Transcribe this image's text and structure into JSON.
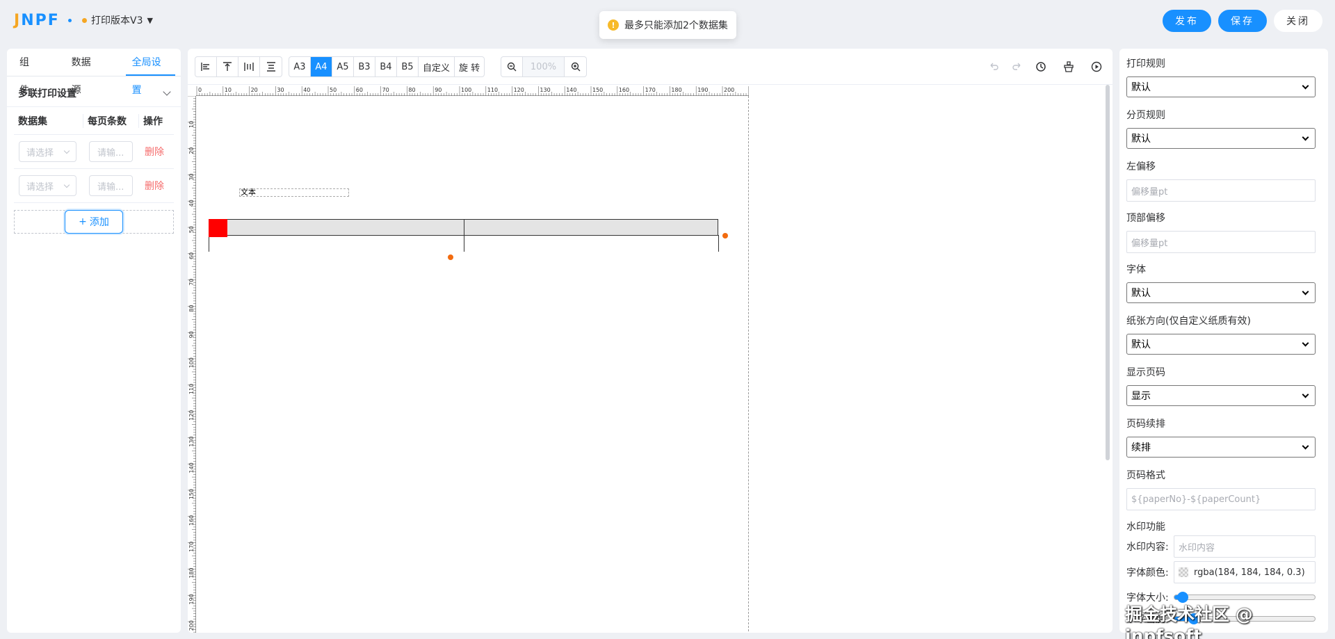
{
  "header": {
    "logo_j": "J",
    "logo_rest": "NPF",
    "version_label": "打印版本V3",
    "toast_text": "最多只能添加2个数据集",
    "buttons": {
      "publish": "发布",
      "save": "保存",
      "close": "关闭"
    },
    "accent_color": "#1890ff"
  },
  "left": {
    "tabs": [
      "组件",
      "数据源",
      "全局设置"
    ],
    "active_tab": "全局设置",
    "section_title": "多联打印设置",
    "table_headers": [
      "数据集",
      "每页条数",
      "操作"
    ],
    "rows": [
      {
        "dataset_placeholder": "请选择",
        "count_placeholder": "请输...",
        "action": "删除"
      },
      {
        "dataset_placeholder": "请选择",
        "count_placeholder": "请输...",
        "action": "删除"
      }
    ],
    "add_label": "添加"
  },
  "toolbar": {
    "paper_sizes": [
      "A3",
      "A4",
      "A5",
      "B3",
      "B4",
      "B5",
      "自定义",
      "旋 转"
    ],
    "active_paper": "A4",
    "zoom": "100%"
  },
  "ruler": {
    "top_marks": [
      "0",
      "10",
      "20",
      "30",
      "40",
      "50",
      "60",
      "70",
      "80",
      "90",
      "100",
      "110",
      "120",
      "130",
      "140",
      "150",
      "160",
      "170",
      "180",
      "190",
      "200"
    ],
    "left_marks": [
      "10",
      "20",
      "30",
      "40",
      "50",
      "60",
      "70",
      "80",
      "90",
      "100",
      "110",
      "120",
      "130",
      "140",
      "150",
      "160",
      "170",
      "180",
      "190",
      "200"
    ]
  },
  "canvas": {
    "text_element": "文本"
  },
  "right": {
    "print_rule": {
      "label": "打印规则",
      "value": "默认"
    },
    "page_rule": {
      "label": "分页规则",
      "value": "默认"
    },
    "left_offset": {
      "label": "左偏移",
      "placeholder": "偏移量pt"
    },
    "top_offset": {
      "label": "顶部偏移",
      "placeholder": "偏移量pt"
    },
    "font": {
      "label": "字体",
      "value": "默认"
    },
    "orientation": {
      "label": "纸张方向(仅自定义纸质有效)",
      "value": "默认"
    },
    "show_page": {
      "label": "显示页码",
      "value": "显示"
    },
    "page_continue": {
      "label": "页码续排",
      "value": "续排"
    },
    "page_format": {
      "label": "页码格式",
      "placeholder": "${paperNo}-${paperCount}"
    },
    "watermark": {
      "title": "水印功能",
      "content_label": "水印内容:",
      "content_placeholder": "水印内容",
      "color_label": "字体颜色:",
      "color_value": "rgba(184, 184, 184, 0.3)",
      "size_label": "字体大小:",
      "density_label": "水平密度:",
      "size_level": 0.06,
      "density_level": 0.14
    }
  },
  "overlay_watermark": "掘金技术社区 @ jnpfsoft"
}
